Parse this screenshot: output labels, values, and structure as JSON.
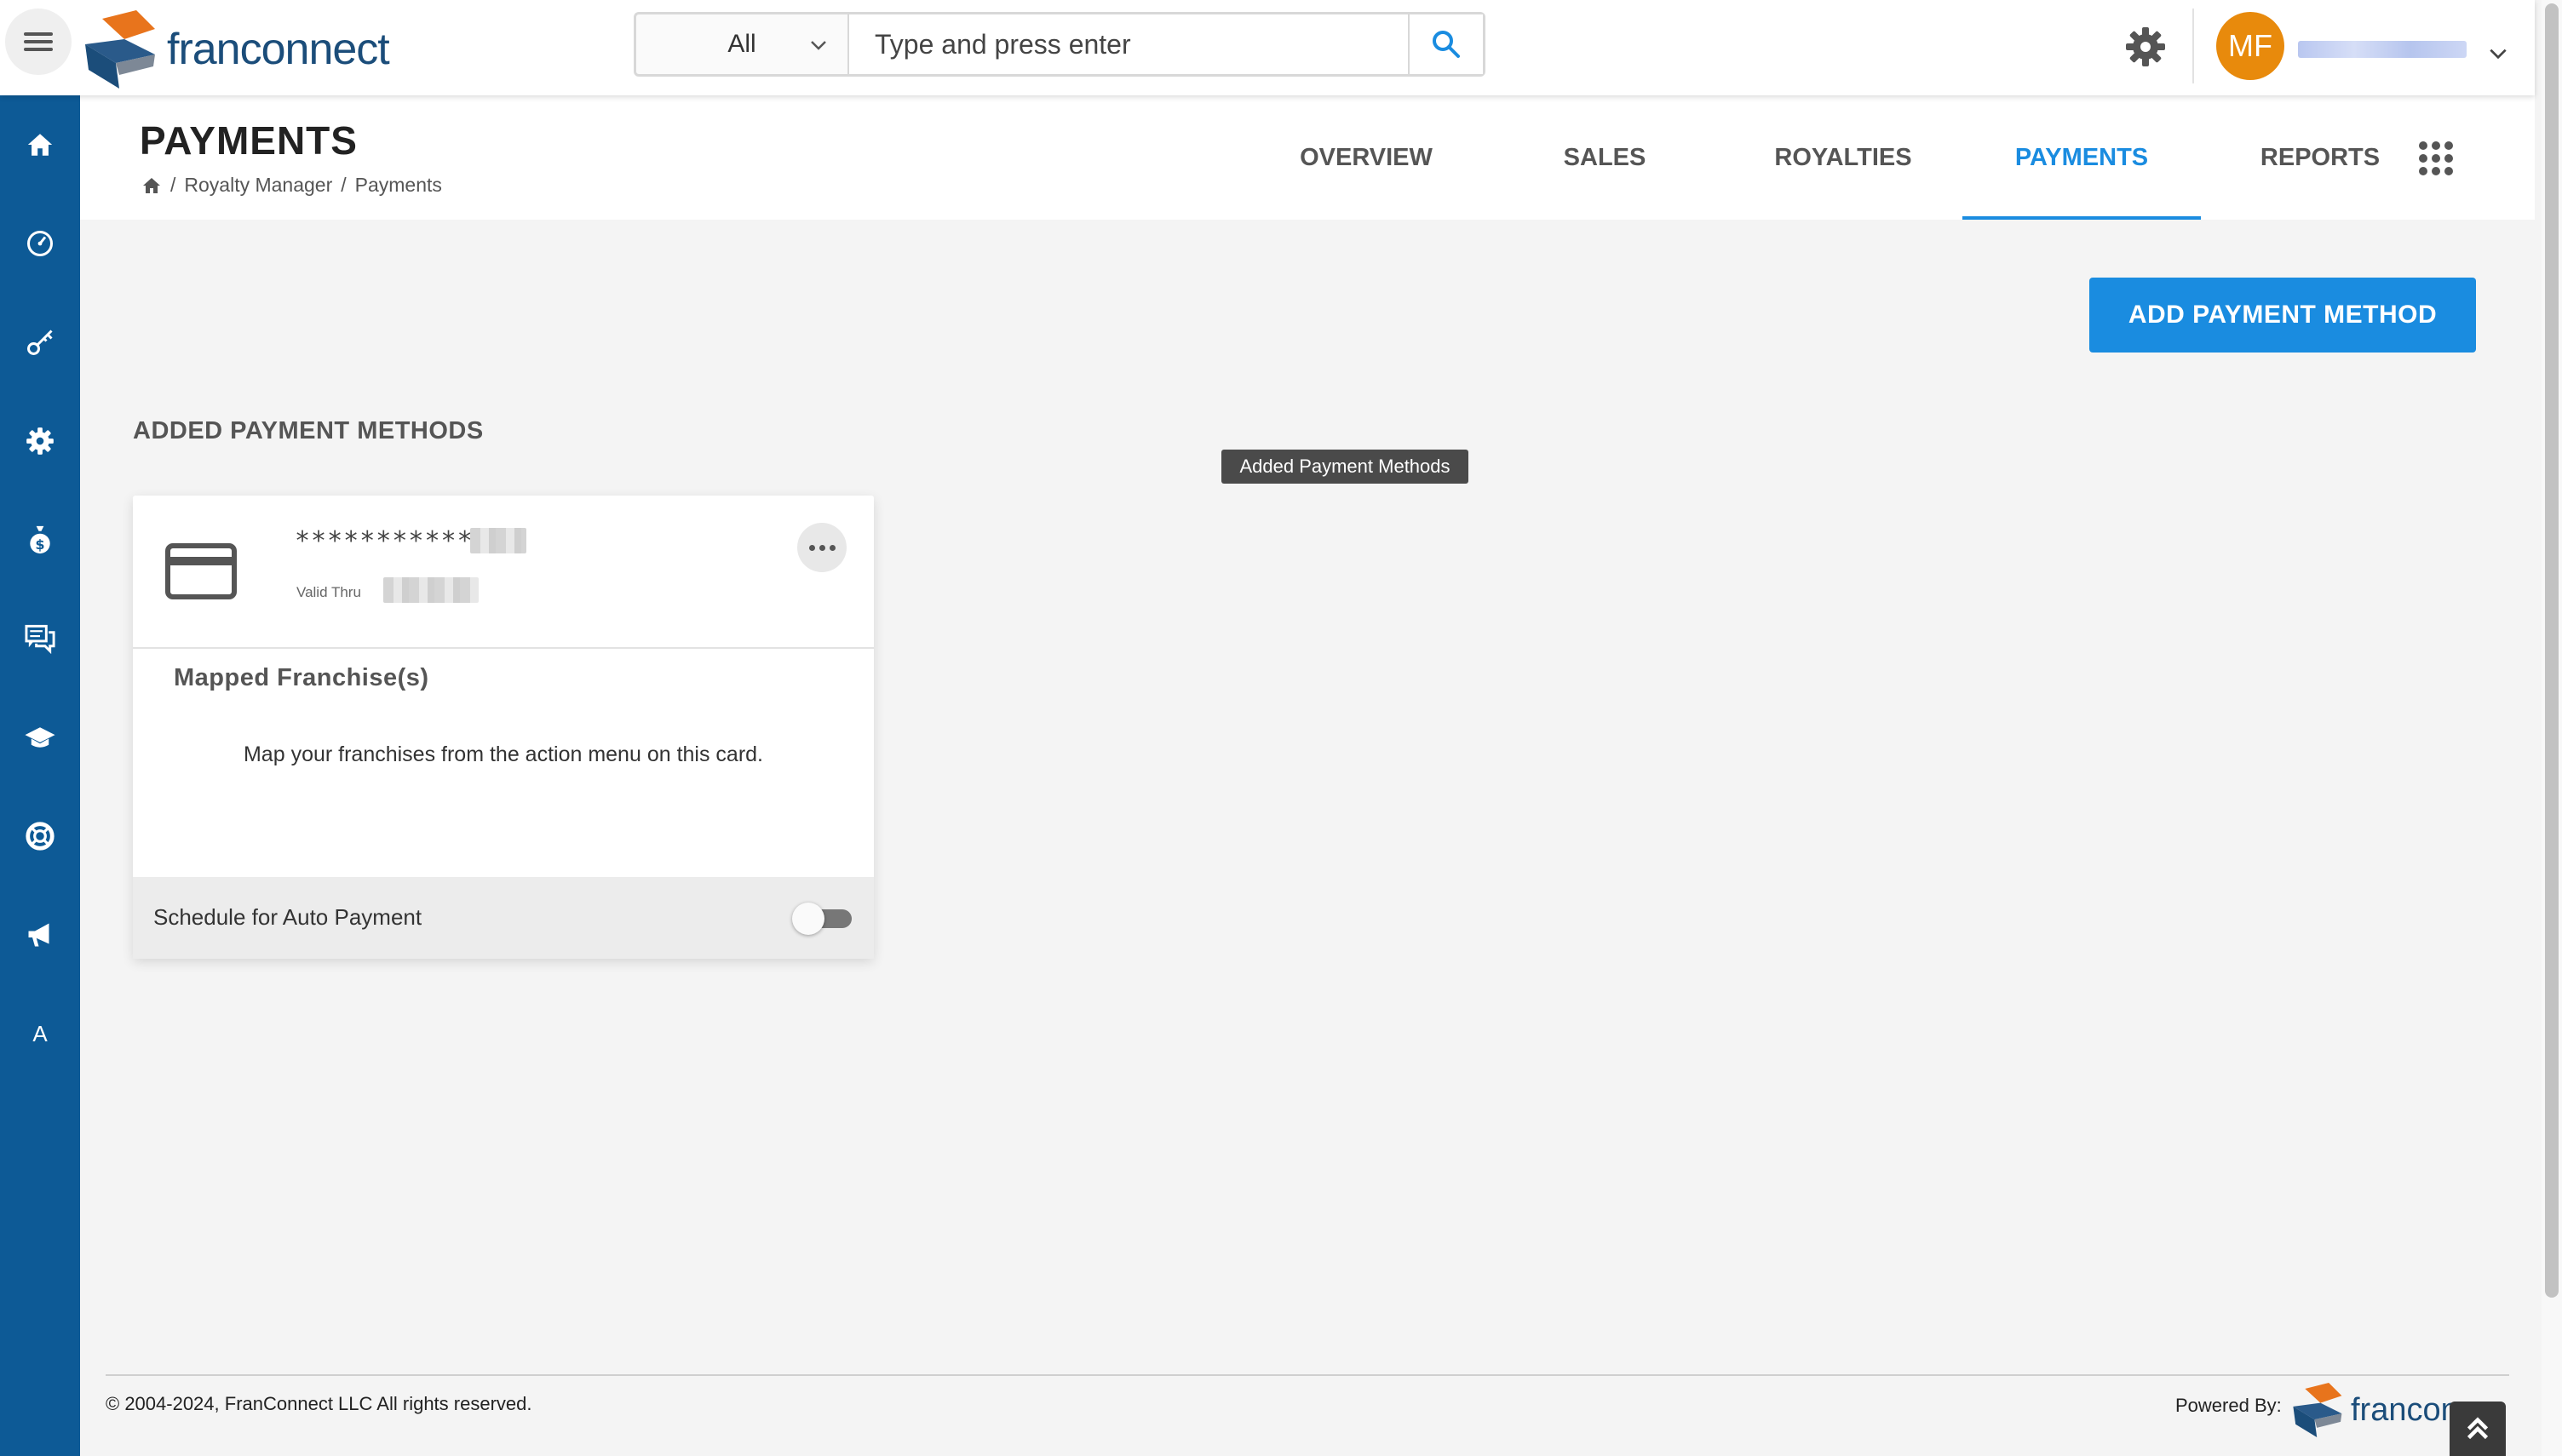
{
  "topbar": {
    "logo_text": "franconnect",
    "search_category": "All",
    "search_placeholder": "Type and press enter",
    "avatar_initials": "MF"
  },
  "sidebar": {
    "items": [
      {
        "icon": "home-icon"
      },
      {
        "icon": "dashboard-icon"
      },
      {
        "icon": "key-icon"
      },
      {
        "icon": "settings-icon"
      },
      {
        "icon": "money-bag-icon"
      },
      {
        "icon": "chat-icon"
      },
      {
        "icon": "graduation-cap-icon"
      },
      {
        "icon": "lifebuoy-icon"
      },
      {
        "icon": "megaphone-icon"
      },
      {
        "icon": "letter-a-icon",
        "label": "A"
      }
    ]
  },
  "header": {
    "title": "PAYMENTS",
    "breadcrumb": [
      "Royalty Manager",
      "Payments"
    ],
    "tabs": [
      {
        "label": "OVERVIEW",
        "active": false
      },
      {
        "label": "SALES",
        "active": false
      },
      {
        "label": "ROYALTIES",
        "active": false
      },
      {
        "label": "PAYMENTS",
        "active": true
      },
      {
        "label": "REPORTS",
        "active": false
      }
    ]
  },
  "main": {
    "add_button_label": "ADD PAYMENT METHOD",
    "section_title": "ADDED PAYMENT METHODS",
    "tooltip": "Added Payment Methods",
    "card": {
      "masked_number": "************",
      "valid_thru_label": "Valid Thru",
      "mapped_title": "Mapped Franchise(s)",
      "mapped_hint": "Map your franchises from the action menu on this card.",
      "auto_payment_label": "Schedule for Auto Payment",
      "auto_payment_enabled": false
    }
  },
  "footer": {
    "copyright": "© 2004-2024, FranConnect LLC All rights reserved.",
    "powered_by": "Powered By:",
    "logo_text": "francon"
  },
  "colors": {
    "accent": "#1a8ce0",
    "sidebar": "#0d5a96",
    "avatar": "#e88a0c"
  }
}
